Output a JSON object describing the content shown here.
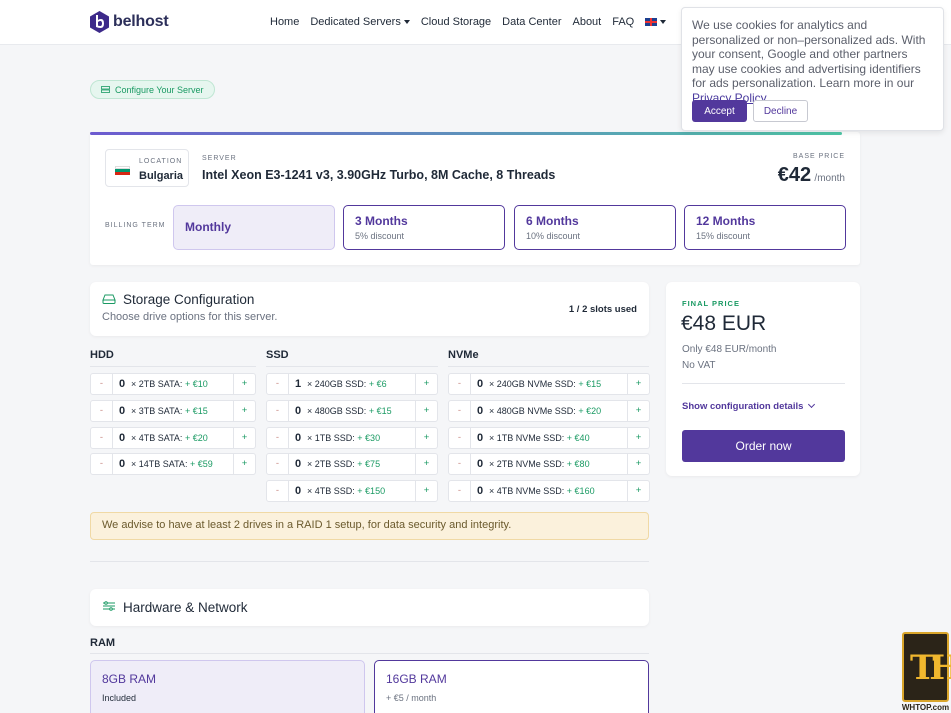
{
  "brand": {
    "name": "belhost"
  },
  "nav": {
    "items": [
      "Home",
      "Dedicated Servers",
      "Cloud Storage",
      "Data Center",
      "About",
      "FAQ"
    ],
    "language_icon": "uk-flag-icon"
  },
  "cookie": {
    "text": "We use cookies for analytics and personalized or non–personalized ads. With your consent, Google and other partners may use cookies and advertising identifiers for ads personalization. Learn more in our ",
    "link": "Privacy Policy.",
    "accept": "Accept",
    "decline": "Decline"
  },
  "configure_pill": "Configure Your Server",
  "server": {
    "location_label": "LOCATION",
    "location": "Bulgaria",
    "server_label": "SERVER",
    "name": "Intel Xeon E3-1241 v3, 3.90GHz Turbo, 8M Cache, 8 Threads",
    "base_price_label": "BASE PRICE",
    "base_price": "€42",
    "base_price_unit": "/month",
    "billing_label": "BILLING TERM",
    "terms": [
      {
        "name": "Monthly",
        "discount": "",
        "selected": true
      },
      {
        "name": "3 Months",
        "discount": "5% discount",
        "selected": false
      },
      {
        "name": "6 Months",
        "discount": "10% discount",
        "selected": false
      },
      {
        "name": "12 Months",
        "discount": "15% discount",
        "selected": false
      }
    ]
  },
  "storage": {
    "title": "Storage Configuration",
    "subtitle": "Choose drive options for this server.",
    "slots": "1 / 2 slots used",
    "columns": [
      {
        "title": "HDD",
        "rows": [
          {
            "qty": "0",
            "label": "× 2TB SATA:",
            "price": "+ €10"
          },
          {
            "qty": "0",
            "label": "× 3TB SATA:",
            "price": "+ €15"
          },
          {
            "qty": "0",
            "label": "× 4TB SATA:",
            "price": "+ €20"
          },
          {
            "qty": "0",
            "label": "× 14TB SATA:",
            "price": "+ €59"
          }
        ]
      },
      {
        "title": "SSD",
        "rows": [
          {
            "qty": "1",
            "label": "× 240GB SSD:",
            "price": "+ €6"
          },
          {
            "qty": "0",
            "label": "× 480GB SSD:",
            "price": "+ €15"
          },
          {
            "qty": "0",
            "label": "× 1TB SSD:",
            "price": "+ €30"
          },
          {
            "qty": "0",
            "label": "× 2TB SSD:",
            "price": "+ €75"
          },
          {
            "qty": "0",
            "label": "× 4TB SSD:",
            "price": "+ €150"
          }
        ]
      },
      {
        "title": "NVMe",
        "rows": [
          {
            "qty": "0",
            "label": "× 240GB NVMe SSD:",
            "price": "+ €15"
          },
          {
            "qty": "0",
            "label": "× 480GB NVMe SSD:",
            "price": "+ €20"
          },
          {
            "qty": "0",
            "label": "× 1TB NVMe SSD:",
            "price": "+ €40"
          },
          {
            "qty": "0",
            "label": "× 2TB NVMe SSD:",
            "price": "+ €80"
          },
          {
            "qty": "0",
            "label": "× 4TB NVMe SSD:",
            "price": "+ €160"
          }
        ]
      }
    ],
    "minus": "-",
    "plus": "+",
    "advise": "We advise to have at least 2 drives in a RAID 1 setup, for data security and integrity."
  },
  "hardware": {
    "title": "Hardware & Network",
    "ram_title": "RAM",
    "ram_options": [
      {
        "name": "8GB RAM",
        "sub": "Included",
        "selected": true
      },
      {
        "name": "16GB RAM",
        "sub": "+ €5 / month",
        "selected": false
      }
    ]
  },
  "final": {
    "label": "FINAL PRICE",
    "amount": "€48 EUR",
    "only": "Only €48 EUR/month",
    "vat": "No VAT",
    "show_details": "Show configuration details",
    "order": "Order now"
  },
  "watermark": {
    "text": "WHTOP.com"
  },
  "colors": {
    "accent": "#52389c",
    "green": "#1a9a63"
  }
}
